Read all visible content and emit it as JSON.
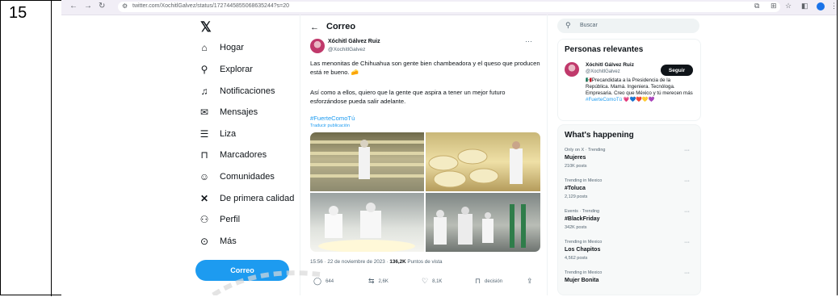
{
  "row_number": "15",
  "browser": {
    "url": "twitter.com/XochitlGalvez/status/1727445855068635244?s=20"
  },
  "nav": {
    "items": [
      {
        "label": "Hogar",
        "icon": "home-icon"
      },
      {
        "label": "Explorar",
        "icon": "search-icon"
      },
      {
        "label": "Notificaciones",
        "icon": "bell-icon"
      },
      {
        "label": "Mensajes",
        "icon": "envelope-icon"
      },
      {
        "label": "Liza",
        "icon": "list-icon"
      },
      {
        "label": "Marcadores",
        "icon": "bookmark-icon"
      },
      {
        "label": "Comunidades",
        "icon": "people-icon"
      },
      {
        "label": "De primera calidad",
        "icon": "x-logo-icon"
      },
      {
        "label": "Perfil",
        "icon": "person-icon"
      },
      {
        "label": "Más",
        "icon": "more-circle-icon"
      }
    ],
    "post_button": "Correo"
  },
  "post": {
    "header_title": "Correo",
    "author_name": "Xóchitl Gálvez Ruiz",
    "author_handle": "@XochitlGalvez",
    "more": "···",
    "text1": "Las menonitas de Chihuahua son gente bien chambeadora y el queso que producen está re bueno. 🧀",
    "text2": "Así como a ellos, quiero que la gente que aspira a tener un mejor futuro esforzándose pueda salir adelante.",
    "hashtag": "#FuerteComoTú",
    "translate": "Traducir publicación",
    "time": "15:56 · 22 de noviembre de 2023 · ",
    "views_count": "136,2K",
    "views_label": " Puntos de vista",
    "replies": "644",
    "reposts": "2,6K",
    "likes": "8,1K",
    "bookmark_label": "decisión"
  },
  "sidebar": {
    "search_placeholder": "Buscar",
    "relevant_title": "Personas relevantes",
    "person_name": "Xóchitl Gálvez Ruiz",
    "person_handle": "@XochitlGalvez",
    "follow_label": "Seguir",
    "person_bio": "🇲🇽Precandidata a la Presidencia de la República. Mamá. Ingeniera. Tecnóloga. Empresaria. Creo que México y tú merecen más",
    "person_bio_tag": "#FuerteComoTú 💗💙❤️💛💜",
    "happening_title": "What's happening",
    "trends": [
      {
        "meta": "Only on X · Trending",
        "name": "Mujeres",
        "count": "210K posts"
      },
      {
        "meta": "Trending in Mexico",
        "name": "#Toluca",
        "count": "2,129 posts"
      },
      {
        "meta": "Events · Trending",
        "name": "#BlackFriday",
        "count": "342K posts"
      },
      {
        "meta": "Trending in Mexico",
        "name": "Los Chapitos",
        "count": "4,562 posts"
      },
      {
        "meta": "Trending in Mexico",
        "name": "Mujer Bonita",
        "count": ""
      }
    ]
  },
  "colors": {
    "accent": "#1d9bf0",
    "text": "#0f1419",
    "muted": "#536471"
  }
}
